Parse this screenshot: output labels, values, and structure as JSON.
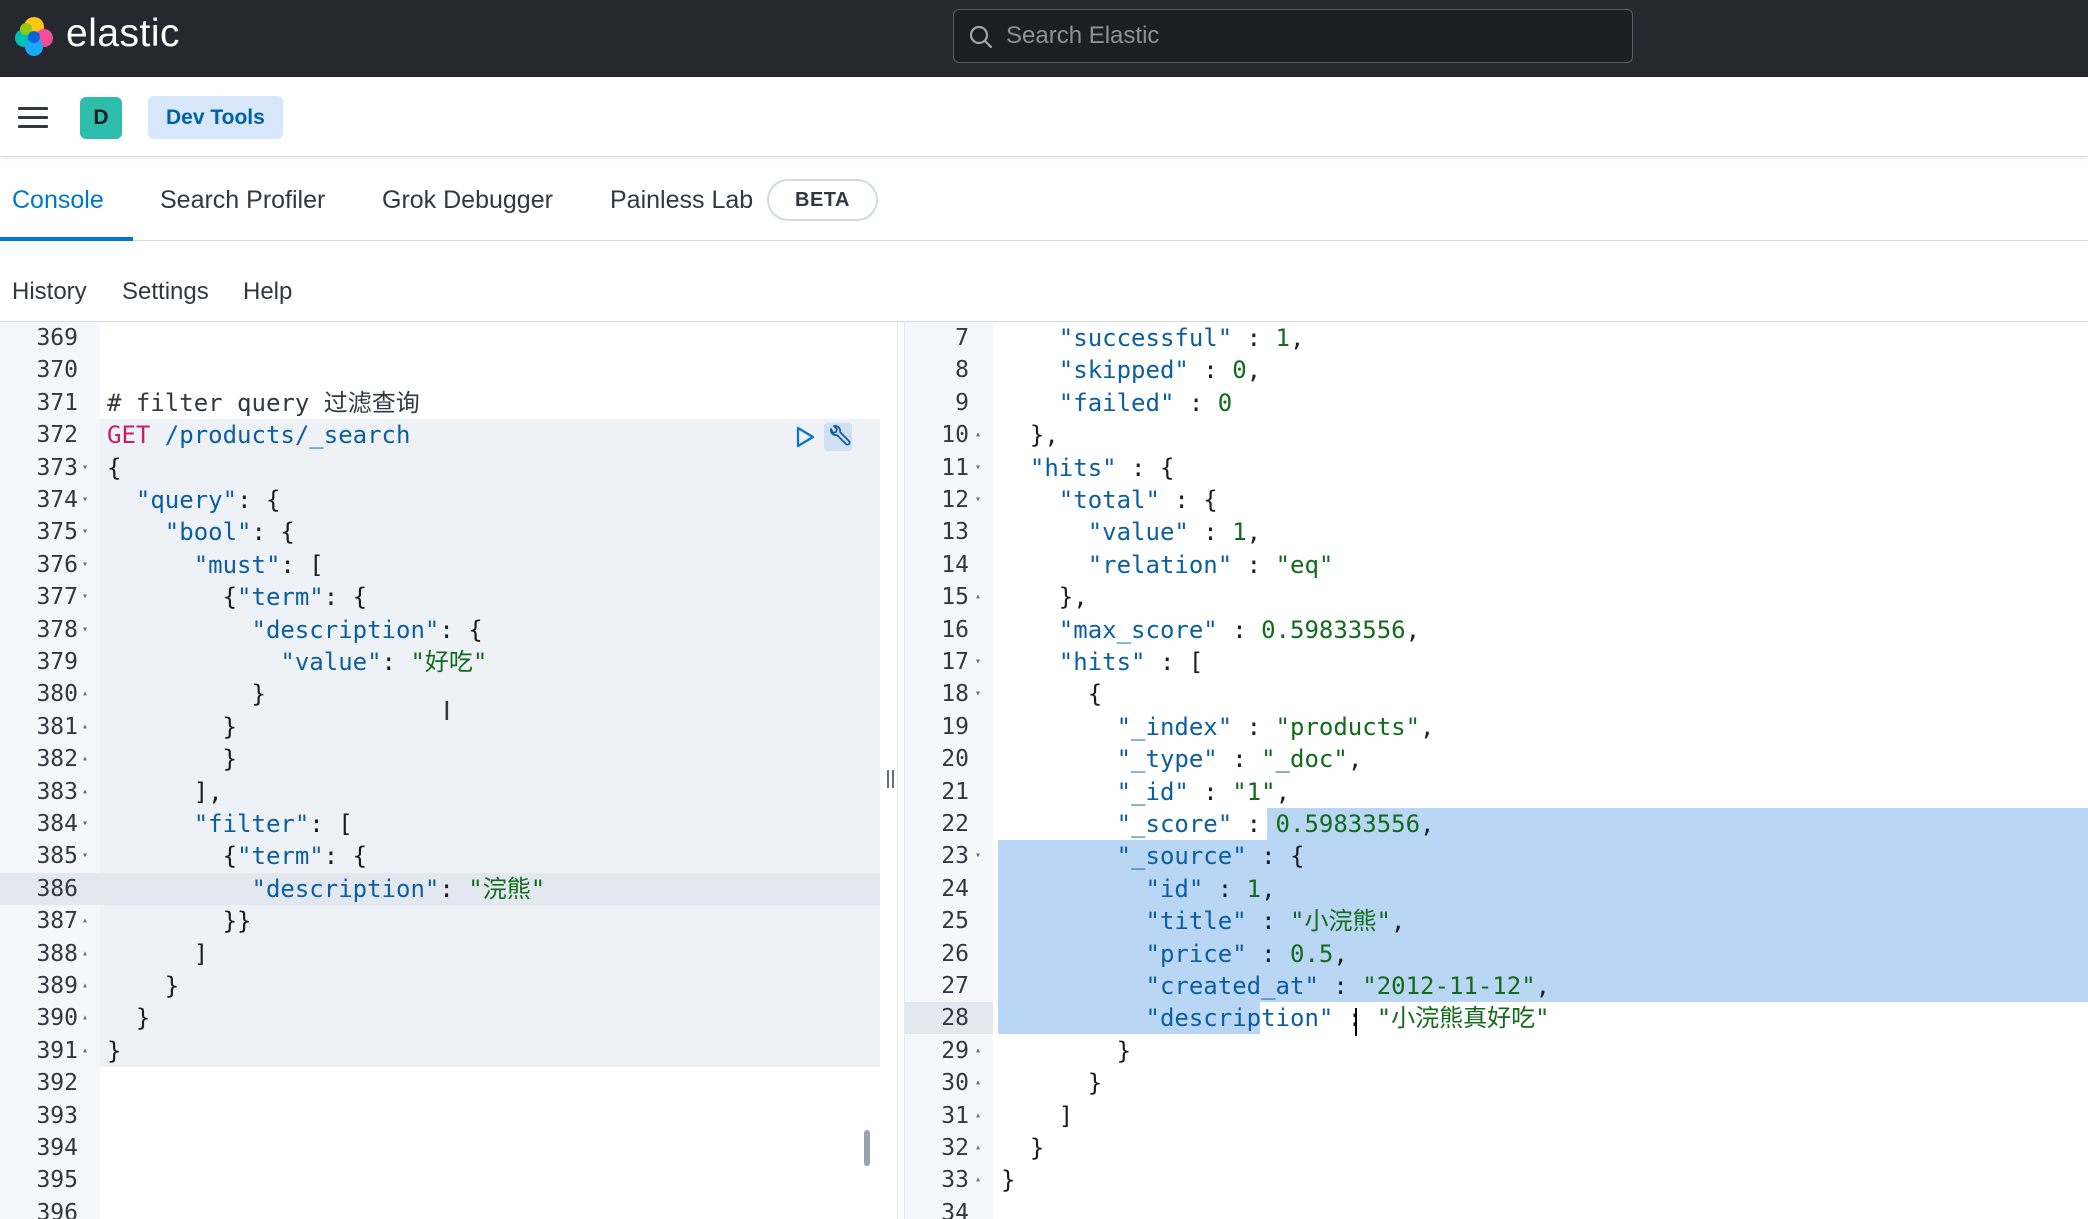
{
  "app": {
    "brand": "elastic",
    "search_placeholder": "Search Elastic",
    "avatar_letter": "D",
    "breadcrumb": "Dev Tools"
  },
  "tabs": [
    {
      "label": "Console",
      "active": true
    },
    {
      "label": "Search Profiler",
      "active": false
    },
    {
      "label": "Grok Debugger",
      "active": false
    },
    {
      "label": "Painless Lab",
      "active": false
    }
  ],
  "beta_badge": "BETA",
  "subnav": [
    "History",
    "Settings",
    "Help"
  ],
  "colors": {
    "topbar": "#25282f",
    "accent": "#0077cc",
    "avatar": "#2ebdad",
    "method": "#c61e63",
    "string": "#126a1b",
    "key": "#0b5f9e"
  },
  "request_editor": {
    "lines": [
      {
        "n": "369",
        "fold": "",
        "text": ""
      },
      {
        "n": "370",
        "fold": "",
        "text": ""
      },
      {
        "n": "371",
        "fold": "",
        "text": "# filter query 过滤查询"
      },
      {
        "n": "372",
        "fold": "",
        "text": "GET /products/_search"
      },
      {
        "n": "373",
        "fold": "▾",
        "text": "{"
      },
      {
        "n": "374",
        "fold": "▾",
        "text": "  \"query\": {"
      },
      {
        "n": "375",
        "fold": "▾",
        "text": "    \"bool\": {"
      },
      {
        "n": "376",
        "fold": "▾",
        "text": "      \"must\": ["
      },
      {
        "n": "377",
        "fold": "▾",
        "text": "        {\"term\": {"
      },
      {
        "n": "378",
        "fold": "▾",
        "text": "          \"description\": {"
      },
      {
        "n": "379",
        "fold": "",
        "text": "            \"value\": \"好吃\""
      },
      {
        "n": "380",
        "fold": "▴",
        "text": "          }"
      },
      {
        "n": "381",
        "fold": "▴",
        "text": "        }"
      },
      {
        "n": "382",
        "fold": "▴",
        "text": "        }"
      },
      {
        "n": "383",
        "fold": "▴",
        "text": "      ],"
      },
      {
        "n": "384",
        "fold": "▾",
        "text": "      \"filter\": ["
      },
      {
        "n": "385",
        "fold": "▾",
        "text": "        {\"term\": {"
      },
      {
        "n": "386",
        "fold": "",
        "text": "          \"description\": \"浣熊\""
      },
      {
        "n": "387",
        "fold": "▴",
        "text": "        }}"
      },
      {
        "n": "388",
        "fold": "▴",
        "text": "      ]"
      },
      {
        "n": "389",
        "fold": "▴",
        "text": "    }"
      },
      {
        "n": "390",
        "fold": "▴",
        "text": "  }"
      },
      {
        "n": "391",
        "fold": "▴",
        "text": "}"
      },
      {
        "n": "392",
        "fold": "",
        "text": ""
      },
      {
        "n": "393",
        "fold": "",
        "text": ""
      },
      {
        "n": "394",
        "fold": "",
        "text": ""
      },
      {
        "n": "395",
        "fold": "",
        "text": ""
      },
      {
        "n": "396",
        "fold": "",
        "text": ""
      }
    ]
  },
  "response_editor": {
    "lines": [
      {
        "n": "7",
        "fold": "",
        "text": "    \"successful\" : 1,"
      },
      {
        "n": "8",
        "fold": "",
        "text": "    \"skipped\" : 0,"
      },
      {
        "n": "9",
        "fold": "",
        "text": "    \"failed\" : 0"
      },
      {
        "n": "10",
        "fold": "▴",
        "text": "  },"
      },
      {
        "n": "11",
        "fold": "▾",
        "text": "  \"hits\" : {"
      },
      {
        "n": "12",
        "fold": "▾",
        "text": "    \"total\" : {"
      },
      {
        "n": "13",
        "fold": "",
        "text": "      \"value\" : 1,"
      },
      {
        "n": "14",
        "fold": "",
        "text": "      \"relation\" : \"eq\""
      },
      {
        "n": "15",
        "fold": "▴",
        "text": "    },"
      },
      {
        "n": "16",
        "fold": "",
        "text": "    \"max_score\" : 0.59833556,"
      },
      {
        "n": "17",
        "fold": "▾",
        "text": "    \"hits\" : ["
      },
      {
        "n": "18",
        "fold": "▾",
        "text": "      {"
      },
      {
        "n": "19",
        "fold": "",
        "text": "        \"_index\" : \"products\","
      },
      {
        "n": "20",
        "fold": "",
        "text": "        \"_type\" : \"_doc\","
      },
      {
        "n": "21",
        "fold": "",
        "text": "        \"_id\" : \"1\","
      },
      {
        "n": "22",
        "fold": "",
        "text": "        \"_score\" : 0.59833556,"
      },
      {
        "n": "23",
        "fold": "▾",
        "text": "        \"_source\" : {"
      },
      {
        "n": "24",
        "fold": "",
        "text": "          \"id\" : 1,"
      },
      {
        "n": "25",
        "fold": "",
        "text": "          \"title\" : \"小浣熊\","
      },
      {
        "n": "26",
        "fold": "",
        "text": "          \"price\" : 0.5,"
      },
      {
        "n": "27",
        "fold": "",
        "text": "          \"created_at\" : \"2012-11-12\","
      },
      {
        "n": "28",
        "fold": "",
        "text": "          \"description\" : \"小浣熊真好吃\""
      },
      {
        "n": "29",
        "fold": "▴",
        "text": "        }"
      },
      {
        "n": "30",
        "fold": "▴",
        "text": "      }"
      },
      {
        "n": "31",
        "fold": "▴",
        "text": "    ]"
      },
      {
        "n": "32",
        "fold": "▴",
        "text": "  }"
      },
      {
        "n": "33",
        "fold": "▴",
        "text": "}"
      },
      {
        "n": "34",
        "fold": "",
        "text": ""
      }
    ]
  }
}
